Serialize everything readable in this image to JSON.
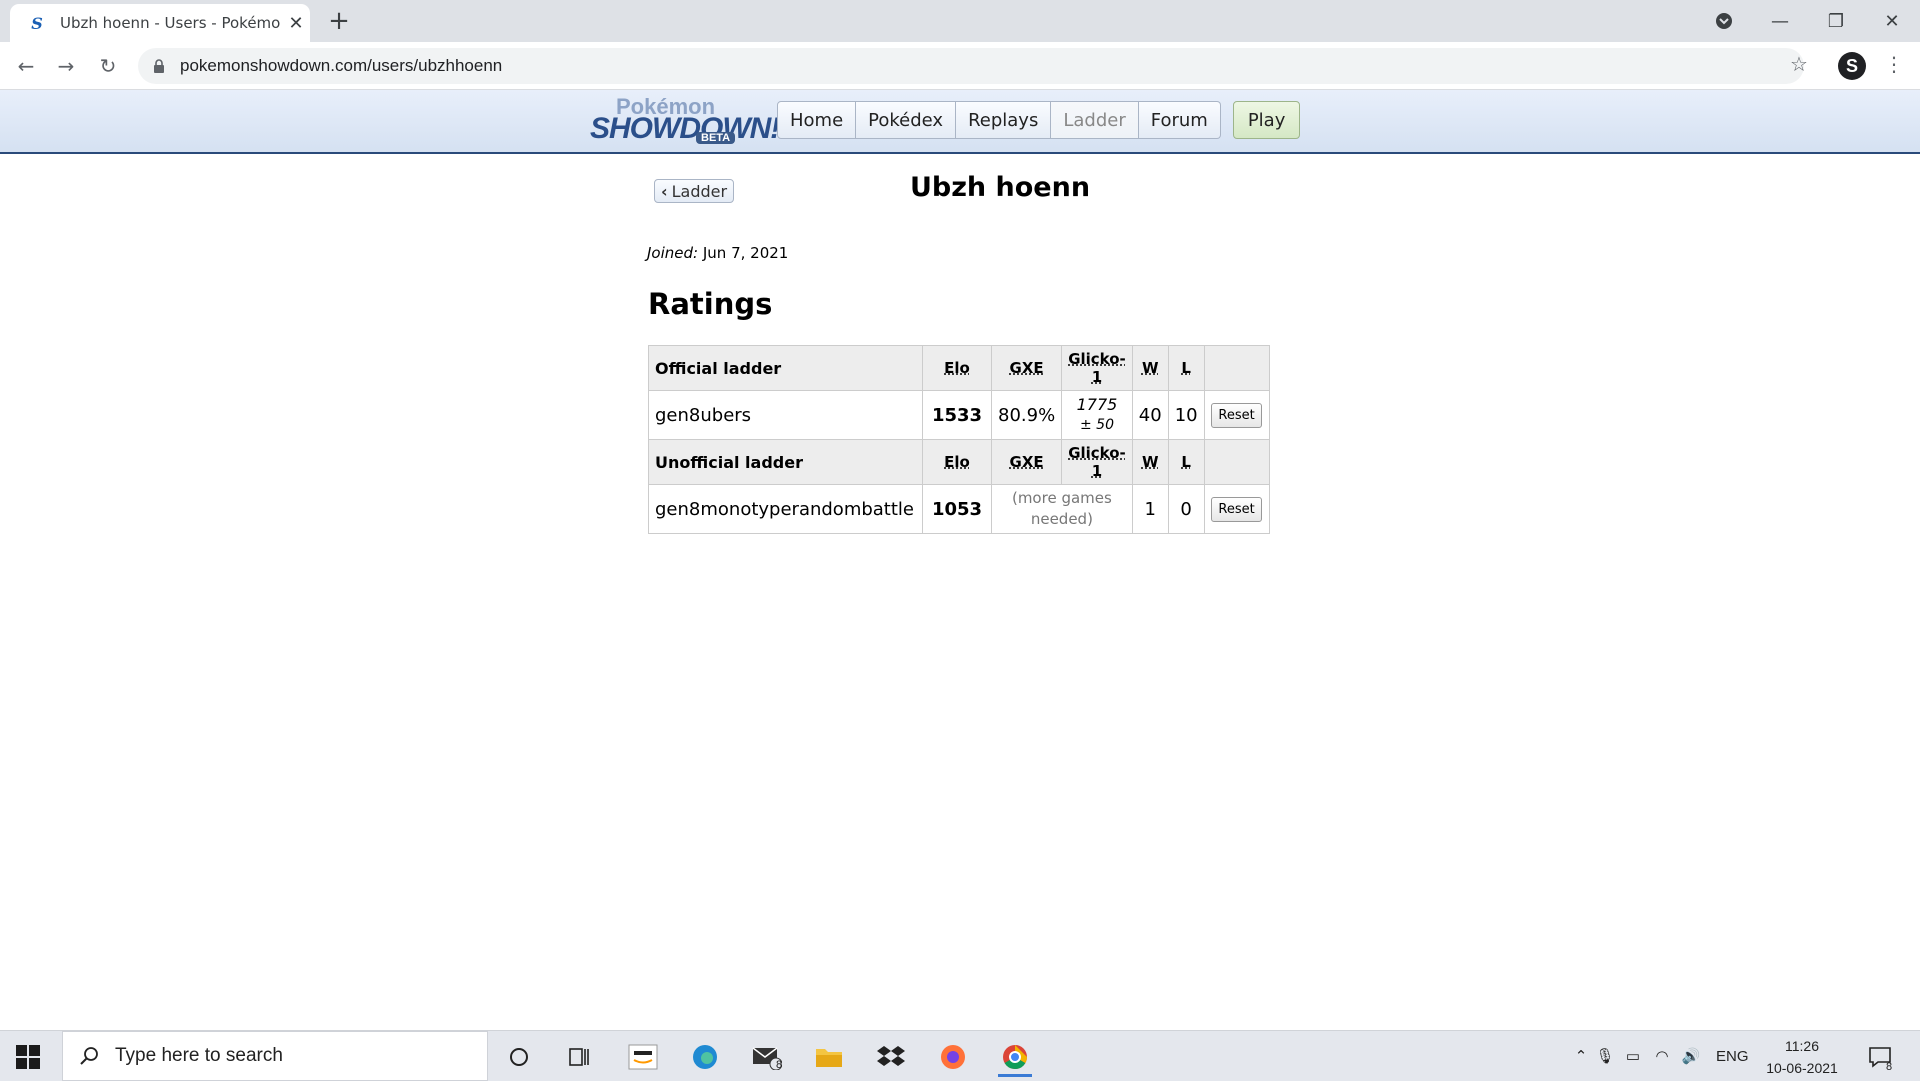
{
  "browser": {
    "tab_title": "Ubzh hoenn - Users - Pokémon Showdown",
    "tab_favicon": "S",
    "close_glyph": "✕",
    "newtab_glyph": "+",
    "url": "pokemonshowdown.com/users/ubzhhoenn",
    "profile_initial": "S",
    "window_controls": {
      "minimize": "—",
      "maximize": "❐",
      "close": "✕"
    }
  },
  "site": {
    "logo_pokemon": "Pokémon",
    "logo_showdown": "SHOWDOWN!",
    "logo_beta": "BETA",
    "nav": [
      "Home",
      "Pokédex",
      "Replays",
      "Ladder",
      "Forum"
    ],
    "current_nav": "Ladder",
    "play_label": "Play"
  },
  "page": {
    "back_label": "Ladder",
    "title": "Ubzh hoenn",
    "joined_label": "Joined:",
    "joined_date": "Jun 7, 2021",
    "ratings_heading": "Ratings"
  },
  "ratings": {
    "official_header": "Official ladder",
    "unofficial_header": "Unofficial ladder",
    "col_elo": "Elo",
    "col_gxe": "GXE",
    "col_glicko": "Glicko-1",
    "col_w": "W",
    "col_l": "L",
    "official": {
      "format": "gen8ubers",
      "elo": "1533",
      "gxe": "80.9%",
      "glicko": "1775",
      "glicko_dev": "± 50",
      "w": "40",
      "l": "10",
      "reset_label": "Reset"
    },
    "unofficial": {
      "format": "gen8monotyperandombattle",
      "elo": "1053",
      "gxe_note": "(more games needed)",
      "w": "1",
      "l": "0",
      "reset_label": "Reset"
    }
  },
  "taskbar": {
    "search_placeholder": "Type here to search",
    "mail_badge": "8",
    "language": "ENG",
    "time": "11:26",
    "date": "10-06-2021",
    "notification_count": "8"
  }
}
